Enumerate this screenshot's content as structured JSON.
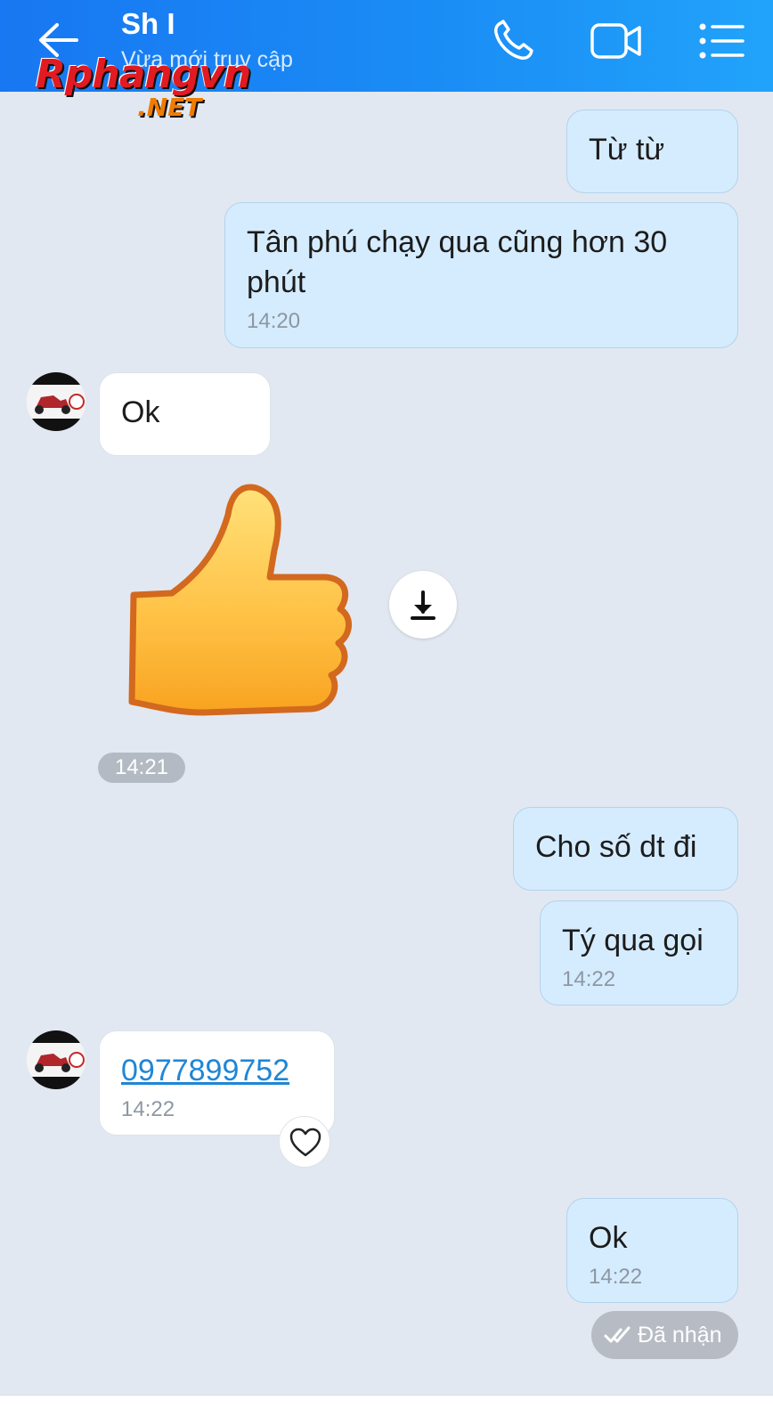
{
  "header": {
    "title": "Sh I",
    "subtitle": "Vừa mới truy cập",
    "back_icon": "arrow-left-icon",
    "call_icon": "phone-icon",
    "video_icon": "video-camera-icon",
    "menu_icon": "list-menu-icon",
    "background": "#1a8cf5"
  },
  "watermark": {
    "main": "Rphangvn",
    "sub": ".NET"
  },
  "messages": [
    {
      "side": "out",
      "text": "Từ từ",
      "time": ""
    },
    {
      "side": "out",
      "text": "Tân phú chạy qua cũng hơn 30 phút",
      "time": "14:20"
    },
    {
      "side": "in",
      "text": "Ok",
      "time": ""
    },
    {
      "side": "in",
      "type": "sticker",
      "sticker": "thumbs-up",
      "time": "14:21"
    },
    {
      "side": "out",
      "text": "Cho số dt đi",
      "time": ""
    },
    {
      "side": "out",
      "text": "Tý qua gọi",
      "time": "14:22"
    },
    {
      "side": "in",
      "text": "0977899752",
      "link": true,
      "time": "14:22"
    },
    {
      "side": "out",
      "text": "Ok",
      "time": "14:22"
    }
  ],
  "status": {
    "received": "Đã nhận"
  },
  "colors": {
    "outgoing_bubble": "#d5ecfe",
    "incoming_bubble": "#ffffff",
    "chat_background": "#e2e8f1",
    "link": "#1f86d6"
  }
}
